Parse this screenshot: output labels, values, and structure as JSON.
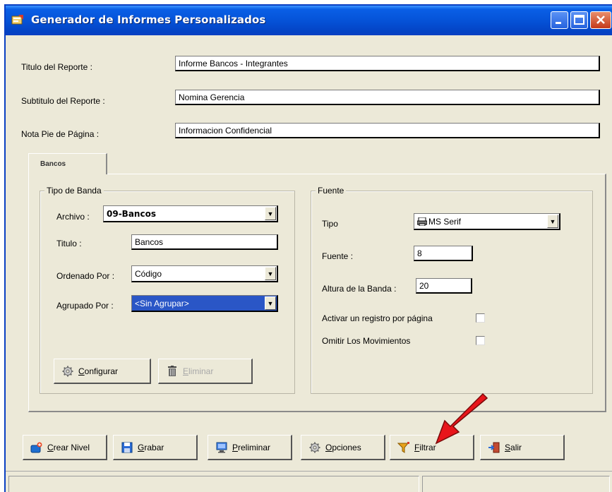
{
  "window": {
    "title": "Generador de Informes Personalizados"
  },
  "form": {
    "titulo_label": "Titulo del Reporte :",
    "titulo_value": "Informe Bancos - Integrantes",
    "subtitulo_label": "Subtitulo del Reporte :",
    "subtitulo_value": "Nomina Gerencia",
    "nota_label": "Nota Pie de Página :",
    "nota_value": "Informacion Confidencial"
  },
  "tabs": [
    {
      "label": "Bancos",
      "active": true
    }
  ],
  "tipo_banda": {
    "title": "Tipo de Banda",
    "archivo_label": "Archivo :",
    "archivo_value": "09-Bancos",
    "titulo_label": "Titulo :",
    "titulo_value": "Bancos",
    "ordenado_label": "Ordenado Por :",
    "ordenado_value": "Código",
    "agrupado_label": "Agrupado Por :",
    "agrupado_value": "<Sin Agrupar>",
    "configurar_label": "Configurar",
    "eliminar_label": "Eliminar"
  },
  "fuente": {
    "title": "Fuente",
    "tipo_label": "Tipo",
    "tipo_value": "MS Serif",
    "fuente_label": "Fuente :",
    "fuente_value": "8",
    "altura_label": "Altura de la Banda :",
    "altura_value": "20",
    "activar_label": "Activar un registro por página",
    "activar_checked": false,
    "omitir_label": "Omitir Los Movimientos",
    "omitir_checked": false
  },
  "buttons": {
    "crear_nivel": "Crear Nivel",
    "grabar": "Grabar",
    "preliminar": "Preliminar",
    "opciones": "Opciones",
    "filtrar": "Filtrar",
    "salir": "Salir"
  },
  "icons": {
    "app": "report-app-icon",
    "crear_nivel": "add-level-icon",
    "grabar": "floppy-save-icon",
    "preliminar": "monitor-preview-icon",
    "opciones": "gear-icon",
    "filtrar": "filter-icon",
    "salir": "exit-door-icon",
    "configurar": "gear-icon",
    "eliminar": "trash-icon",
    "fuente_tipo": "printer-font-icon",
    "annotation": "red-arrow-icon"
  },
  "colors": {
    "titlebar": "#0553d8",
    "window_bg": "#ece9d8",
    "selection": "#2a56c6",
    "annotation_arrow": "#e8151b"
  }
}
